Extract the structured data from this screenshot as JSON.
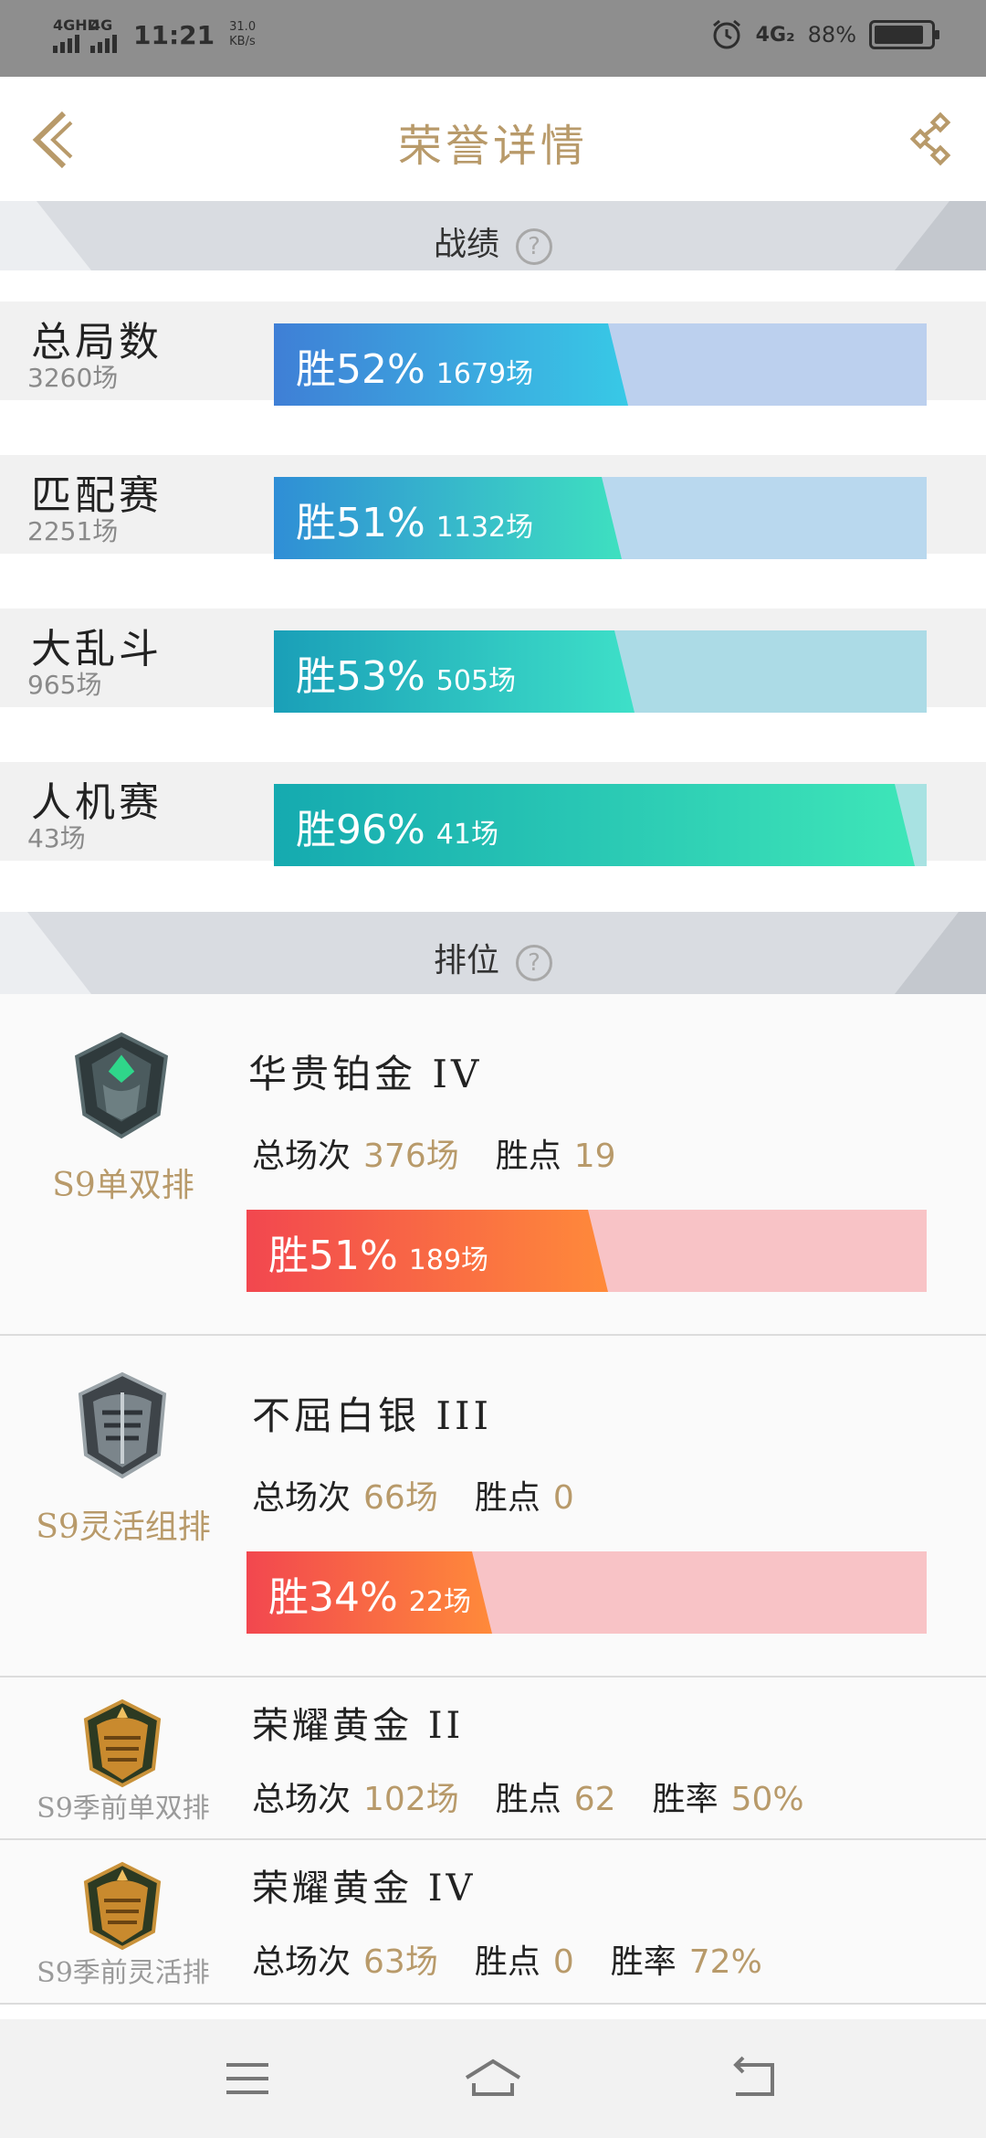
{
  "status_bar": {
    "sim1": "4GHD",
    "sim2": "4G",
    "time": "11:21",
    "speed_value": "31.0",
    "speed_unit": "KB/s",
    "net2": "4G₂",
    "battery": "88%",
    "battery_level": 0.88
  },
  "header": {
    "title": "荣誉详情"
  },
  "sections": {
    "stats_title": "战绩",
    "rank_title": "排位",
    "help": "?"
  },
  "stats": [
    {
      "name": "总局数",
      "count": "3260场",
      "win_label": "胜52%",
      "games": "1679场",
      "win_rate": 0.52,
      "colors": [
        "#3f7fd6",
        "#38c9e6"
      ],
      "track": "#bcd0ee"
    },
    {
      "name": "匹配赛",
      "count": "2251场",
      "win_label": "胜51%",
      "games": "1132场",
      "win_rate": 0.51,
      "colors": [
        "#2f8ed6",
        "#3ee0c0"
      ],
      "track": "#b9d8ee"
    },
    {
      "name": "大乱斗",
      "count": "965场",
      "win_label": "胜53%",
      "games": "505场",
      "win_rate": 0.53,
      "colors": [
        "#1a9fb8",
        "#3ee0c8"
      ],
      "track": "#acdbe6"
    },
    {
      "name": "人机赛",
      "count": "43场",
      "win_label": "胜96%",
      "games": "41场",
      "win_rate": 0.96,
      "colors": [
        "#15aab0",
        "#3ee6b8"
      ],
      "track": "#a8e2e2"
    }
  ],
  "ranks": [
    {
      "queue": "S9单双排",
      "tier": "华贵铂金 IV",
      "total_label": "总场次",
      "total": "376场",
      "lp_label": "胜点",
      "lp": "19",
      "win_label": "胜51%",
      "games": "189场",
      "win_rate": 0.51,
      "emblem": "platinum-emblem"
    },
    {
      "queue": "S9灵活组排",
      "tier": "不屈白银 III",
      "total_label": "总场次",
      "total": "66场",
      "lp_label": "胜点",
      "lp": "0",
      "win_label": "胜34%",
      "games": "22场",
      "win_rate": 0.34,
      "emblem": "silver-emblem"
    },
    {
      "queue": "S9季前单双排",
      "tier": "荣耀黄金 II",
      "total_label": "总场次",
      "total": "102场",
      "lp_label": "胜点",
      "lp": "62",
      "rate_label": "胜率",
      "rate": "50%",
      "emblem": "gold-emblem"
    },
    {
      "queue": "S9季前灵活排",
      "tier": "荣耀黄金 IV",
      "total_label": "总场次",
      "total": "63场",
      "lp_label": "胜点",
      "lp": "0",
      "rate_label": "胜率",
      "rate": "72%",
      "emblem": "gold-emblem"
    }
  ],
  "colors": {
    "accent_gold": "#b89a6a",
    "section_bg": "#d9dce1",
    "rank_track": "#f8c3c6"
  },
  "nav": {
    "menu": "menu-icon",
    "home": "home-icon",
    "back": "back-icon"
  }
}
